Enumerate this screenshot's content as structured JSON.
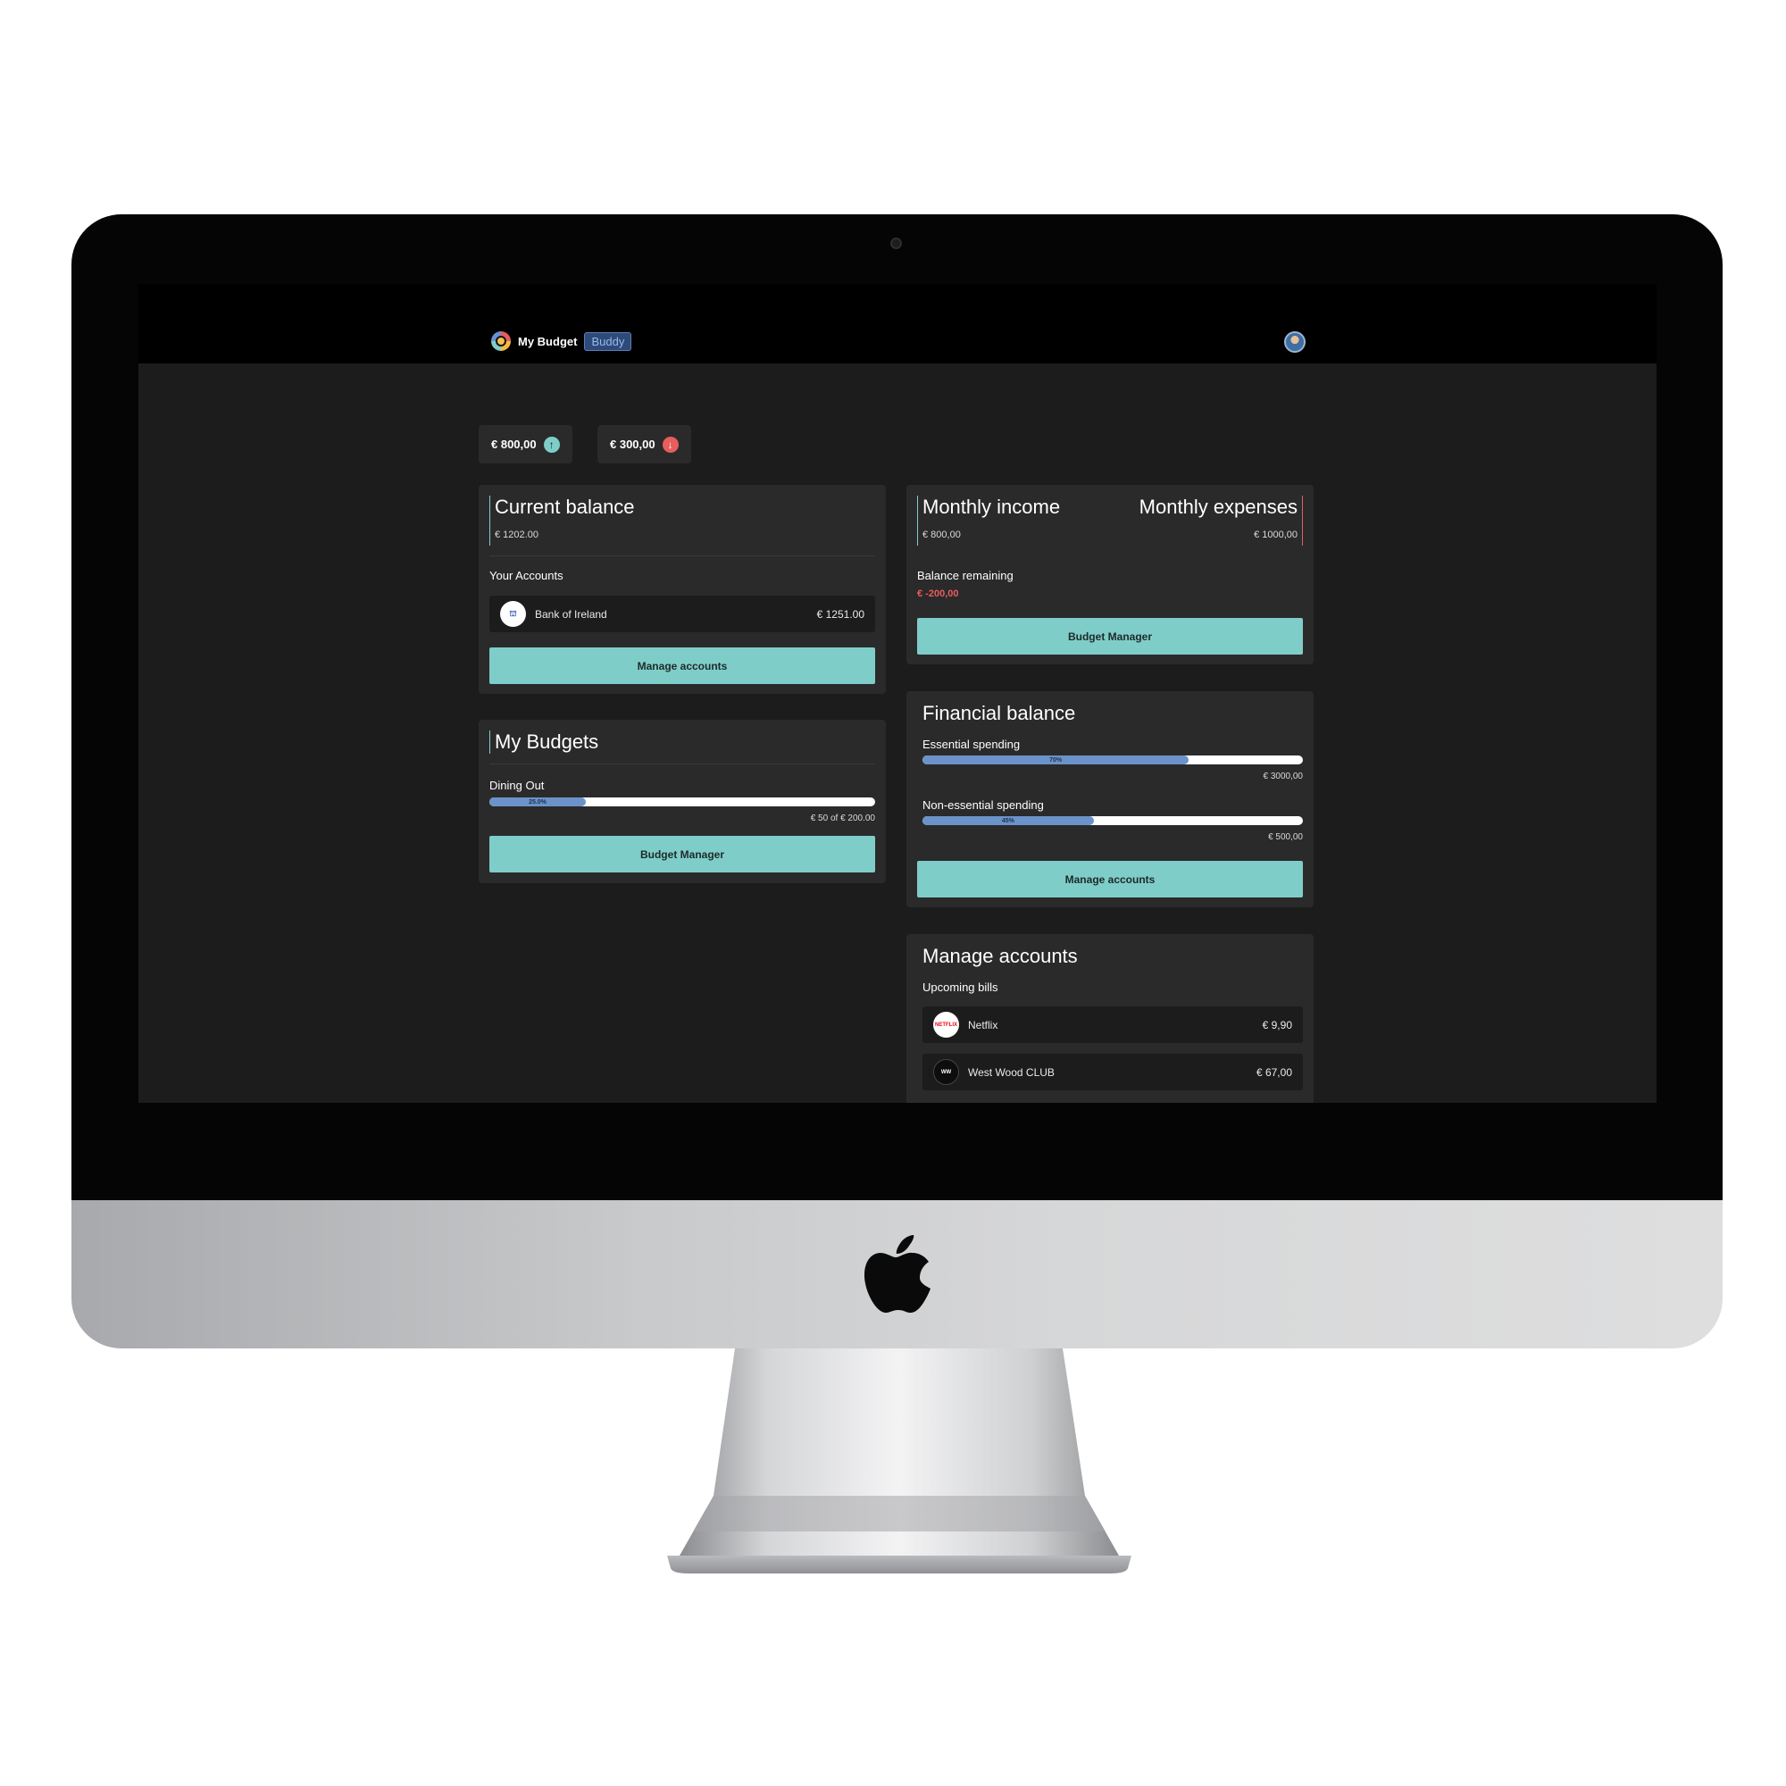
{
  "header": {
    "brand_name": "My Budget",
    "brand_badge": "Buddy",
    "brand_logo_icon": "money-bag-icon",
    "avatar_icon": "user-avatar-icon"
  },
  "summary": {
    "income_chip": "€ 800,00",
    "expense_chip": "€ 300,00"
  },
  "current_balance": {
    "title": "Current balance",
    "amount": "€ 1202.00",
    "accounts_label": "Your Accounts",
    "accounts": [
      {
        "name": "Bank of Ireland",
        "amount": "€ 1251.00",
        "logo_icon": "bank-of-ireland-logo-icon"
      }
    ],
    "button": "Manage accounts"
  },
  "my_budgets": {
    "title": "My Budgets",
    "items": [
      {
        "name": "Dining Out",
        "progress_label": "25.0%",
        "progress": 0.25,
        "caption": "€ 50 of € 200.00"
      }
    ],
    "button": "Budget Manager"
  },
  "monthly": {
    "income_title": "Monthly income",
    "income_amount": "€ 800,00",
    "expenses_title": "Monthly expenses",
    "expenses_amount": "€ 1000,00",
    "remaining_label": "Balance remaining",
    "remaining_amount": "€ -200,00",
    "button": "Budget Manager"
  },
  "financial_balance": {
    "title": "Financial balance",
    "items": [
      {
        "name": "Essential spending",
        "progress_label": "70%",
        "progress": 0.7,
        "amount": "€ 3000,00"
      },
      {
        "name": "Non-essential spending",
        "progress_label": "45%",
        "progress": 0.45,
        "amount": "€ 500,00"
      }
    ],
    "button": "Manage accounts"
  },
  "bills": {
    "title": "Manage accounts",
    "subtitle": "Upcoming bills",
    "items": [
      {
        "name": "Netflix",
        "amount": "€ 9,90",
        "logo_text": "NETFLIX"
      },
      {
        "name": "West Wood CLUB",
        "amount": "€ 67,00",
        "logo_text": "WW"
      }
    ]
  },
  "colors": {
    "accent": "#7fcdc8",
    "negative": "#e85d5d",
    "progress": "#6b93c9",
    "card": "#2a2a2b",
    "background": "#1c1c1d"
  }
}
